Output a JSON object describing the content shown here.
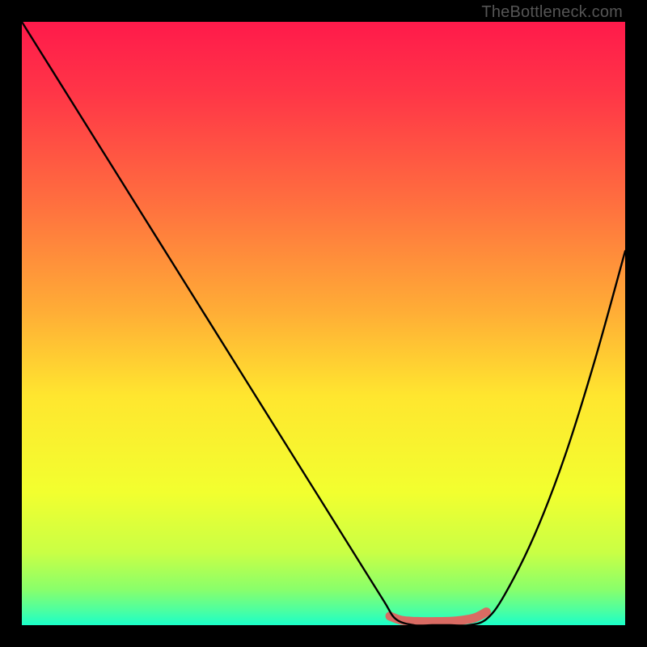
{
  "watermark": "TheBottleneck.com",
  "chart_data": {
    "type": "line",
    "title": "",
    "xlabel": "",
    "ylabel": "",
    "xlim": [
      0,
      100
    ],
    "ylim": [
      0,
      100
    ],
    "series": [
      {
        "name": "bottleneck-curve",
        "x": [
          0,
          5,
          10,
          15,
          20,
          25,
          30,
          35,
          40,
          45,
          50,
          55,
          60,
          62,
          65,
          68,
          71,
          74,
          77,
          80,
          85,
          90,
          95,
          100
        ],
        "values": [
          100,
          92,
          84,
          76,
          68,
          60,
          52,
          44,
          36,
          28,
          20,
          12,
          4,
          1,
          0,
          0,
          0,
          0,
          1,
          5,
          15,
          28,
          44,
          62
        ]
      },
      {
        "name": "ideal-band",
        "x": [
          61,
          63,
          66,
          69,
          72,
          75,
          77
        ],
        "values": [
          1.5,
          0.8,
          0.6,
          0.6,
          0.7,
          1.2,
          2.2
        ]
      }
    ],
    "gradient": {
      "stops": [
        {
          "pos": 0.0,
          "color": "#ff1a4b"
        },
        {
          "pos": 0.12,
          "color": "#ff3647"
        },
        {
          "pos": 0.3,
          "color": "#ff6f3f"
        },
        {
          "pos": 0.48,
          "color": "#ffad36"
        },
        {
          "pos": 0.62,
          "color": "#ffe62f"
        },
        {
          "pos": 0.78,
          "color": "#f2ff2f"
        },
        {
          "pos": 0.88,
          "color": "#c9ff45"
        },
        {
          "pos": 0.94,
          "color": "#8aff6a"
        },
        {
          "pos": 0.975,
          "color": "#4dffa0"
        },
        {
          "pos": 1.0,
          "color": "#1affc9"
        }
      ]
    },
    "colors": {
      "curve": "#000000",
      "ideal_band": "#d96b63",
      "frame": "#000000"
    }
  }
}
